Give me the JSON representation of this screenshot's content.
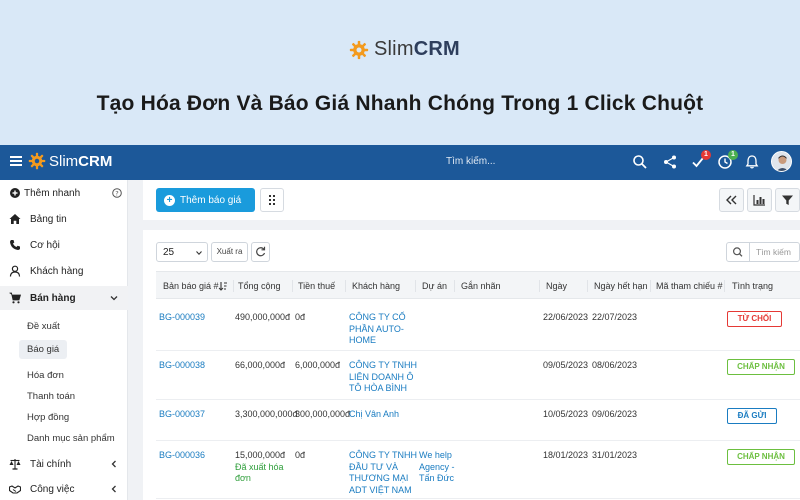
{
  "banner": {
    "brand_prefix": "Slim",
    "brand_suffix": "CRM",
    "headline": "Tạo Hóa Đơn Và Báo Giá Nhanh Chóng Trong 1 Click Chuột"
  },
  "topbar": {
    "brand_prefix": "Slim",
    "brand_suffix": "CRM",
    "search_placeholder": "Tìm kiếm...",
    "task_badge": "1",
    "timer_badge": "1",
    "colors": {
      "bar": "#1c5899",
      "badge_red": "#e53935",
      "badge_green": "#4caf50"
    }
  },
  "sidebar": {
    "quick_add": "Thêm nhanh",
    "items": [
      {
        "label": "Bảng tin",
        "icon": "home-icon"
      },
      {
        "label": "Cơ hội",
        "icon": "phone-icon"
      },
      {
        "label": "Khách hàng",
        "icon": "user-icon"
      },
      {
        "label": "Bán hàng",
        "icon": "cart-icon"
      }
    ],
    "sales_sub": [
      "Đề xuất",
      "Báo giá",
      "Hóa đơn",
      "Thanh toán",
      "Hợp đồng",
      "Danh mục sản phẩm"
    ],
    "finance": "Tài chính",
    "work": "Công việc"
  },
  "toolbar": {
    "add_quote": "Thêm báo giá"
  },
  "table_controls": {
    "page_size": "25",
    "export": "Xuất ra",
    "search_placeholder": "Tìm kiếm"
  },
  "table": {
    "headers": [
      "Bản báo giá #",
      "Tổng cộng",
      "Tiền thuế",
      "Khách hàng",
      "Dự án",
      "Gắn nhãn",
      "Ngày",
      "Ngày hết hạn",
      "Mã tham chiếu #",
      "Tình trạng"
    ],
    "rows": [
      {
        "id": "BG-000039",
        "total": "490,000,000đ",
        "tax": "0đ",
        "customer": [
          "CÔNG TY CỔ",
          "PHẦN AUTO-",
          "HOME"
        ],
        "project": [],
        "note": [],
        "date": "22/06/2023",
        "expiry": "22/07/2023",
        "status": "TỪ CHỐI",
        "status_color": "#e53935"
      },
      {
        "id": "BG-000038",
        "total": "66,000,000đ",
        "tax": "6,000,000đ",
        "customer": [
          "CÔNG TY TNHH",
          "LIÊN DOANH Ô",
          "TÔ HÒA BÌNH"
        ],
        "project": [],
        "note": [],
        "date": "09/05/2023",
        "expiry": "08/06/2023",
        "status": "CHẤP NHẬN",
        "status_color": "#6cbf3f"
      },
      {
        "id": "BG-000037",
        "total": "3,300,000,000đ",
        "tax": "300,000,000đ",
        "customer": [
          "Chị Vân Anh"
        ],
        "project": [],
        "note": [],
        "date": "10/05/2023",
        "expiry": "09/06/2023",
        "status": "ĐÃ GỬI",
        "status_color": "#1a7cc1"
      },
      {
        "id": "BG-000036",
        "total": "15,000,000đ",
        "tax": "0đ",
        "customer": [
          "CÔNG TY TNHH",
          "ĐẦU TƯ VÀ",
          "THƯƠNG MẠI",
          "ADT VIỆT NAM"
        ],
        "project": [
          "We help",
          "Agency -",
          "Tấn Đức"
        ],
        "note": [
          "Đã xuất hóa",
          "đơn"
        ],
        "date": "18/01/2023",
        "expiry": "31/01/2023",
        "status": "CHẤP NHẬN",
        "status_color": "#6cbf3f"
      }
    ]
  }
}
